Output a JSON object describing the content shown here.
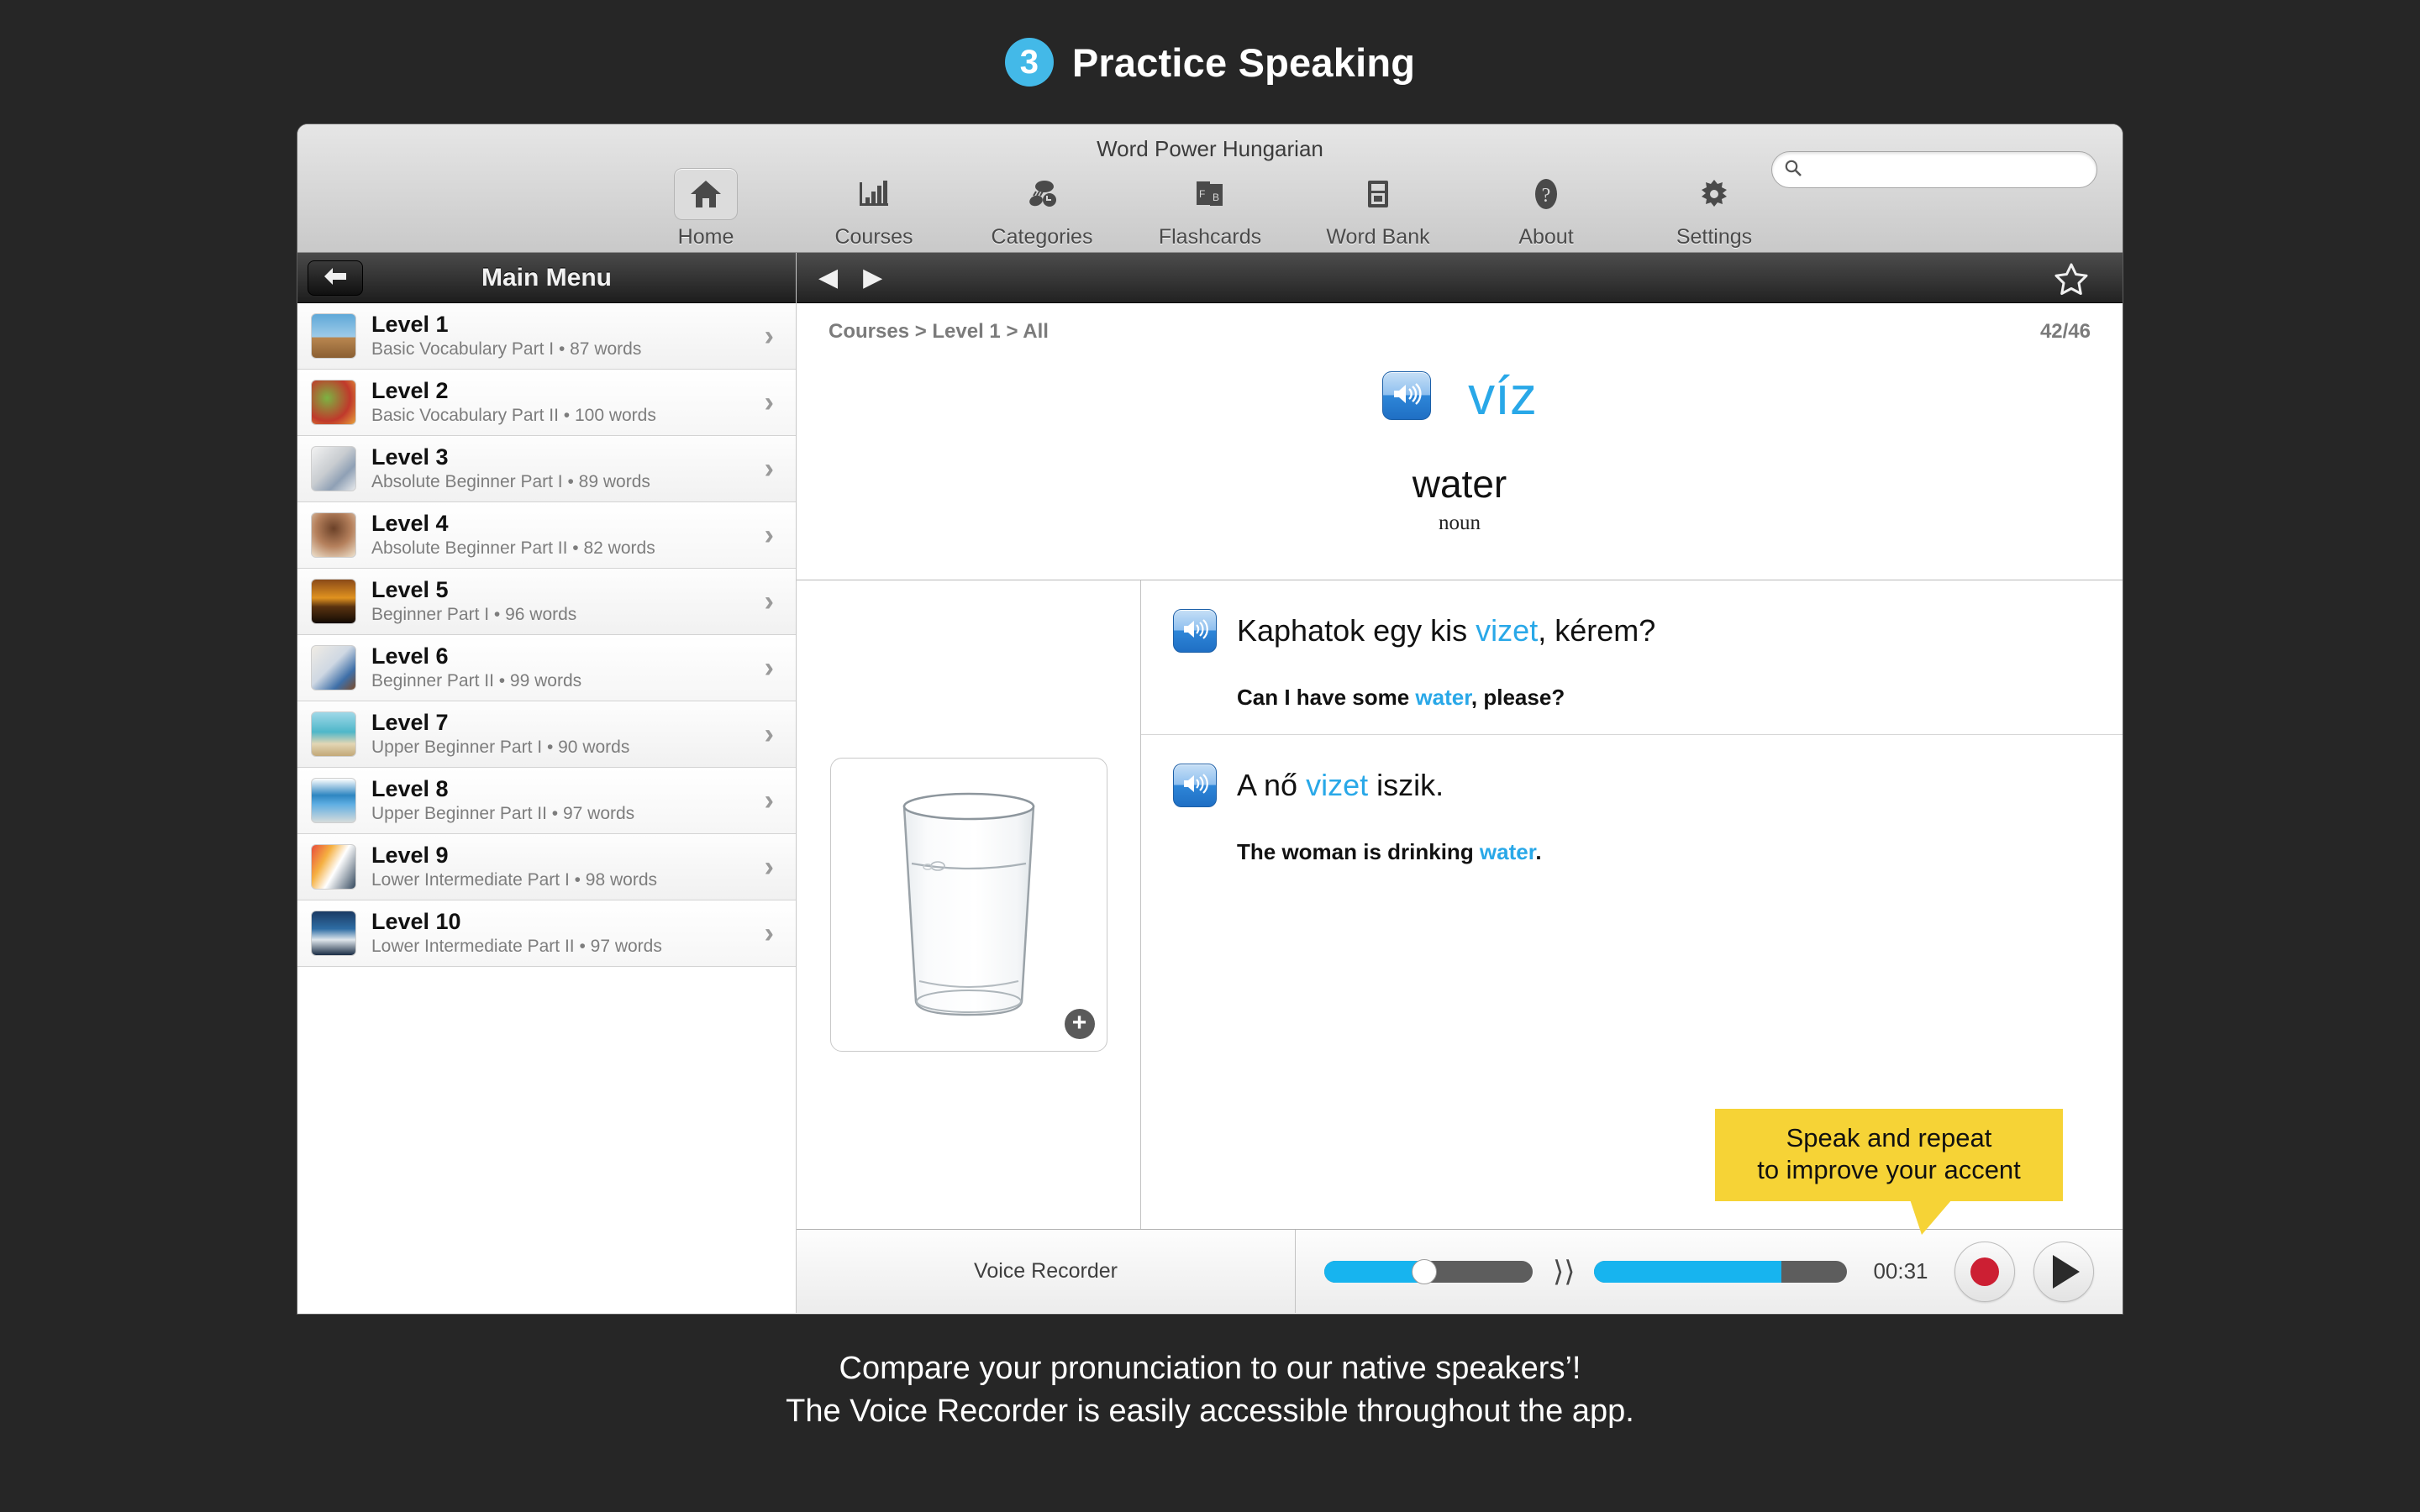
{
  "banner": {
    "step_number": "3",
    "title": "Practice Speaking",
    "badge_color": "#43b9e8"
  },
  "window": {
    "title": "Word Power Hungarian"
  },
  "toolbar": {
    "items": [
      {
        "label": "Home",
        "icon": "home-icon",
        "active": true
      },
      {
        "label": "Courses",
        "icon": "bar-chart-icon",
        "active": false
      },
      {
        "label": "Categories",
        "icon": "categories-icon",
        "active": false
      },
      {
        "label": "Flashcards",
        "icon": "flashcards-icon",
        "active": false
      },
      {
        "label": "Word Bank",
        "icon": "word-bank-icon",
        "active": false
      },
      {
        "label": "About",
        "icon": "question-icon",
        "active": false
      },
      {
        "label": "Settings",
        "icon": "gear-icon",
        "active": false
      }
    ],
    "search": {
      "value": "",
      "placeholder": "",
      "icon": "search-icon"
    }
  },
  "sidebar": {
    "header_title": "Main Menu",
    "back_icon": "back-arrow-icon",
    "items": [
      {
        "name": "Level 1",
        "subtitle": "Basic Vocabulary Part I • 87 words",
        "thumb": "hurdler-photo"
      },
      {
        "name": "Level 2",
        "subtitle": "Basic Vocabulary Part II • 100 words",
        "thumb": "vegetables-photo"
      },
      {
        "name": "Level 3",
        "subtitle": "Absolute Beginner Part I • 89 words",
        "thumb": "keys-photo"
      },
      {
        "name": "Level 4",
        "subtitle": "Absolute Beginner Part II • 82 words",
        "thumb": "brushing-teeth-photo"
      },
      {
        "name": "Level 5",
        "subtitle": "Beginner Part I • 96 words",
        "thumb": "sunset-photo"
      },
      {
        "name": "Level 6",
        "subtitle": "Beginner Part II • 99 words",
        "thumb": "bed-photo"
      },
      {
        "name": "Level 7",
        "subtitle": "Upper Beginner Part I • 90 words",
        "thumb": "beach-hammock-photo"
      },
      {
        "name": "Level 8",
        "subtitle": "Upper Beginner Part II • 97 words",
        "thumb": "laptop-photo"
      },
      {
        "name": "Level 9",
        "subtitle": "Lower Intermediate Part I • 98 words",
        "thumb": "classroom-photo"
      },
      {
        "name": "Level 10",
        "subtitle": "Lower Intermediate Part II • 97 words",
        "thumb": "runner-photo"
      }
    ]
  },
  "main": {
    "nav": {
      "prev_icon": "prev-arrow-icon",
      "next_icon": "next-arrow-icon",
      "favorite_icon": "star-outline-icon"
    },
    "breadcrumb": "Courses > Level 1 > All",
    "counter": "42/46",
    "headword": "víz",
    "headword_color": "#29a8e8",
    "gloss": "water",
    "part_of_speech": "noun",
    "image": {
      "alt": "glass-of-water-photo",
      "zoom_icon": "plus-circle-icon"
    },
    "sentences": [
      {
        "target_before": "Kaphatok egy kis ",
        "target_highlight": "vizet",
        "target_after": ", kérem?",
        "english_before": "Can I have some ",
        "english_highlight": "water",
        "english_after": ", please?",
        "speaker_icon": "speaker-icon"
      },
      {
        "target_before": "A nő ",
        "target_highlight": "vizet",
        "target_after": " iszik.",
        "english_before": "The woman is drinking ",
        "english_highlight": "water",
        "english_after": ".",
        "speaker_icon": "speaker-icon"
      }
    ]
  },
  "callout": {
    "line1": "Speak and repeat",
    "line2": "to improve your accent",
    "background": "#f6d336"
  },
  "recorder": {
    "label": "Voice Recorder",
    "volume_percent": 48,
    "progress_percent": 74,
    "time": "00:31",
    "record_icon": "record-dot-icon",
    "play_icon": "play-triangle-icon",
    "wave_icon": "sound-wave-icon"
  },
  "caption": {
    "line1": "Compare your pronunciation to our native speakers’!",
    "line2": "The Voice Recorder is easily accessible throughout the app."
  }
}
